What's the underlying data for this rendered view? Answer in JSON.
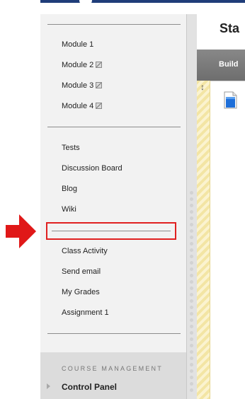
{
  "sidebar": {
    "modules": [
      {
        "label": "Module 1",
        "hidden": false
      },
      {
        "label": "Module 2",
        "hidden": true
      },
      {
        "label": "Module 3",
        "hidden": true
      },
      {
        "label": "Module 4",
        "hidden": true
      }
    ],
    "tools": [
      "Tests",
      "Discussion Board",
      "Blog",
      "Wiki"
    ],
    "links": [
      "Class Activity",
      "Send email",
      "My Grades",
      "Assignment 1"
    ],
    "course_management": {
      "title": "COURSE MANAGEMENT",
      "control_panel_label": "Control Panel"
    }
  },
  "content": {
    "title": "Sta",
    "build_label": "Build"
  },
  "annotation": {
    "color": "#e02020"
  },
  "colors": {
    "top_bar": "#1f3d79",
    "content_icon": "#1e6fd9"
  }
}
